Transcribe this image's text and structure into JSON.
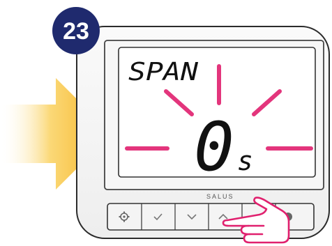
{
  "step": {
    "number": "23",
    "badge_color": "#1f2a6e"
  },
  "display": {
    "mode_label": "SPAN",
    "value": "0",
    "unit": "s",
    "blink_color": "#e0206e"
  },
  "device": {
    "brand": "SALUS"
  },
  "buttons": [
    {
      "name": "settings-button",
      "icon": "gear-icon"
    },
    {
      "name": "confirm-button",
      "icon": "check-icon"
    },
    {
      "name": "down-button",
      "icon": "chevron-down-icon"
    },
    {
      "name": "up-button",
      "icon": "chevron-up-icon"
    },
    {
      "name": "back-button",
      "icon": "arrow-icon"
    },
    {
      "name": "power-button",
      "icon": "power-icon"
    }
  ],
  "pointer_arrow_color": "#f6c23a",
  "hand_outline_color": "#e0206e"
}
